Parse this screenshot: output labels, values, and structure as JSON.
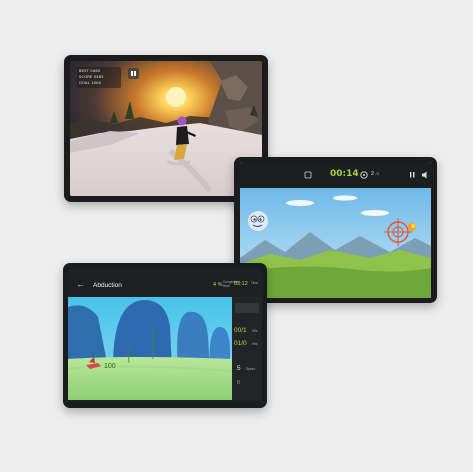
{
  "snowboard_game": {
    "hud_lines": [
      "BEST 0465",
      "SCORE 0465",
      "GOAL 1000"
    ],
    "pause_icon": "pause-icon"
  },
  "shooter_game": {
    "timer": "00:14",
    "lives": "2",
    "lives_total": "/3",
    "left_icon": "menu-icon",
    "target_icon": "life-icon",
    "right_icons": [
      "pause-icon",
      "sound-icon"
    ]
  },
  "flight_game": {
    "title": "Abduction",
    "back_icon": "back-arrow-icon",
    "percent": "4 %",
    "percent_label": "Completion level",
    "time": "03:12",
    "time_label": "Time",
    "panel": {
      "value_1": "00/1",
      "label_1": "Hits",
      "value_2": "01/0",
      "label_2": "Hits",
      "value_3": "5",
      "label_3": "Speed",
      "value_4": "0"
    },
    "target_text": "100"
  }
}
